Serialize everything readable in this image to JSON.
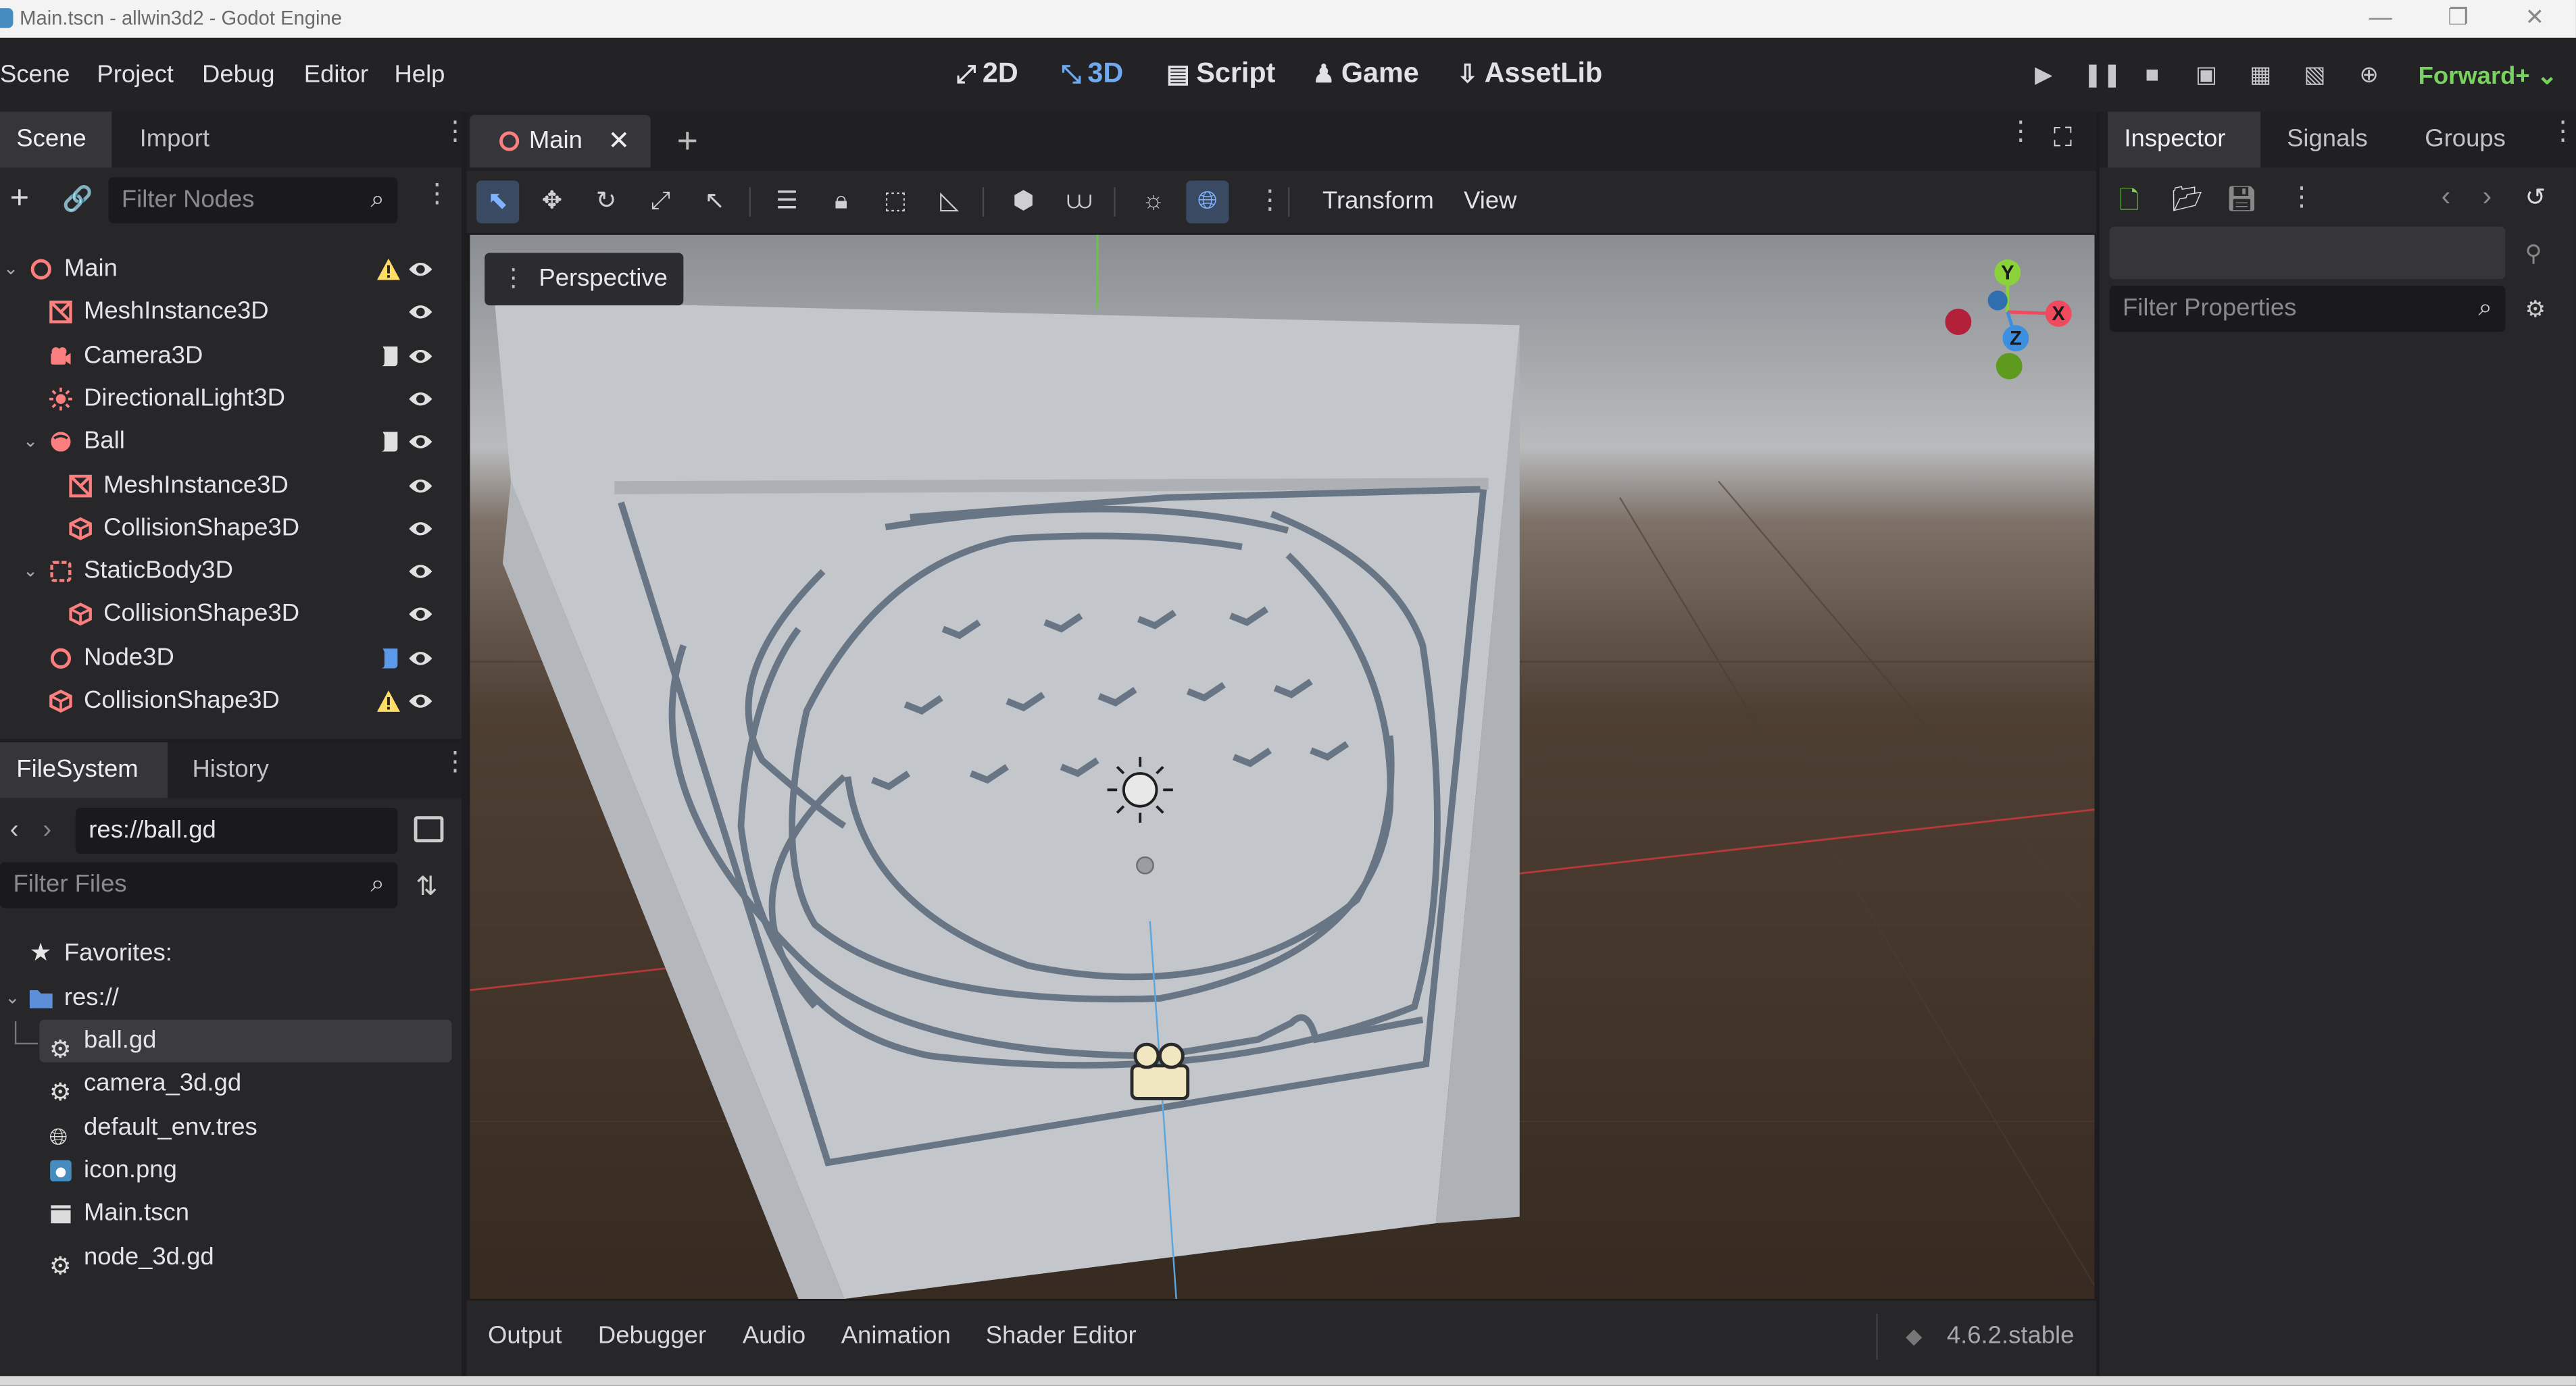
{
  "window": {
    "title": "Main.tscn - allwin3d2 - Godot Engine"
  },
  "menubar": {
    "menus": [
      "Scene",
      "Project",
      "Debug",
      "Editor",
      "Help"
    ],
    "workspaces": [
      "2D",
      "3D",
      "Script",
      "Game",
      "AssetLib"
    ],
    "active_workspace": "3D",
    "renderer": "Forward+"
  },
  "scene_dock": {
    "tabs": [
      "Scene",
      "Import"
    ],
    "filter_placeholder": "Filter Nodes",
    "nodes": [
      {
        "name": "Main",
        "icon": "node3d-root-icon",
        "depth": 0,
        "expanded": true,
        "warning": true,
        "script": false
      },
      {
        "name": "MeshInstance3D",
        "icon": "mesh-instance-icon",
        "depth": 1,
        "warning": false,
        "script": false
      },
      {
        "name": "Camera3D",
        "icon": "camera-icon",
        "depth": 1,
        "warning": false,
        "script": true
      },
      {
        "name": "DirectionalLight3D",
        "icon": "sun-light-icon",
        "depth": 1,
        "warning": false,
        "script": false
      },
      {
        "name": "Ball",
        "icon": "rigid-body-icon",
        "depth": 1,
        "expanded": true,
        "warning": false,
        "script": true
      },
      {
        "name": "MeshInstance3D",
        "icon": "mesh-instance-icon",
        "depth": 2,
        "warning": false,
        "script": false
      },
      {
        "name": "CollisionShape3D",
        "icon": "collision-shape-icon",
        "depth": 2,
        "warning": false,
        "script": false
      },
      {
        "name": "StaticBody3D",
        "icon": "static-body-icon",
        "depth": 1,
        "expanded": true,
        "warning": false,
        "script": false
      },
      {
        "name": "CollisionShape3D",
        "icon": "collision-shape-icon",
        "depth": 2,
        "warning": false,
        "script": false
      },
      {
        "name": "Node3D",
        "icon": "node3d-icon",
        "depth": 1,
        "warning": false,
        "script": true,
        "script_blue": true
      },
      {
        "name": "CollisionShape3D",
        "icon": "collision-shape-icon",
        "depth": 1,
        "warning": true,
        "script": false
      }
    ]
  },
  "filesystem_dock": {
    "tabs": [
      "FileSystem",
      "History"
    ],
    "path": "res://ball.gd",
    "filter_placeholder": "Filter Files",
    "favorites_label": "Favorites:",
    "root_label": "res://",
    "files": [
      {
        "name": "ball.gd",
        "icon": "gear-script-icon",
        "selected": true
      },
      {
        "name": "camera_3d.gd",
        "icon": "gear-script-icon",
        "selected": false
      },
      {
        "name": "default_env.tres",
        "icon": "globe-resource-icon",
        "selected": false
      },
      {
        "name": "icon.png",
        "icon": "image-file-icon",
        "selected": false
      },
      {
        "name": "Main.tscn",
        "icon": "scene-clapper-icon",
        "selected": false
      },
      {
        "name": "node_3d.gd",
        "icon": "gear-script-icon",
        "selected": false
      }
    ]
  },
  "editor": {
    "scene_tab": "Main",
    "toolbar_menus": [
      "Transform",
      "View"
    ],
    "viewport_label": "Perspective",
    "gizmo_axes": [
      "Y",
      "X",
      "Z"
    ]
  },
  "bottom_panel": {
    "tabs": [
      "Output",
      "Debugger",
      "Audio",
      "Animation",
      "Shader Editor"
    ],
    "version": "4.6.2.stable"
  },
  "inspector": {
    "tabs": [
      "Inspector",
      "Signals",
      "Groups"
    ],
    "filter_placeholder": "Filter Properties"
  },
  "colors": {
    "accent": "#6fa9f0",
    "renderer": "#79d15f",
    "node_red": "#fc7f7f",
    "warning": "#ffdd65"
  }
}
